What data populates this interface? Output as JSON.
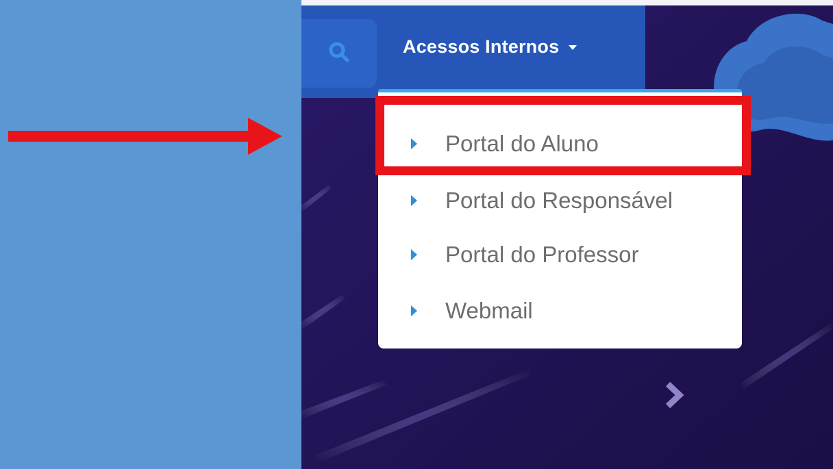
{
  "navbar": {
    "search_icon": "search-icon",
    "dropdown_label": "Acessos Internos"
  },
  "menu": {
    "items": [
      {
        "label": "Portal do Aluno",
        "highlighted": true
      },
      {
        "label": "Portal do Responsável"
      },
      {
        "label": "Portal do Professor"
      },
      {
        "label": "Webmail"
      }
    ]
  },
  "colors": {
    "annotation": "#e8141a",
    "page_background": "#5b97d3",
    "navbar": "#2657b8",
    "site_background": "#1e1250",
    "menu_accent": "#3ea6e6",
    "bullet": "#2f8fd8"
  }
}
